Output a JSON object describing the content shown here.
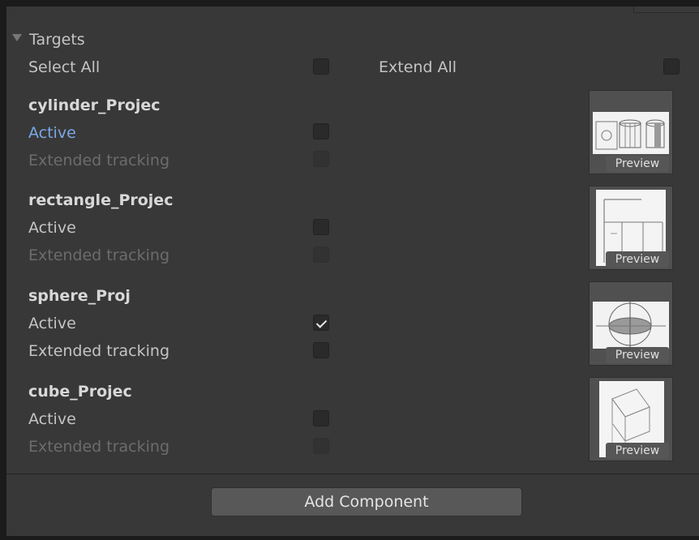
{
  "section": {
    "title": "Targets"
  },
  "bulk": {
    "select_all_label": "Select All",
    "extend_all_label": "Extend All"
  },
  "targets": [
    {
      "name": "cylinder_Projec",
      "active_label": "Active",
      "active_checked": false,
      "active_highlighted": true,
      "extended_label": "Extended tracking",
      "extended_checked": false,
      "extended_enabled": false,
      "preview_label": "Preview"
    },
    {
      "name": "rectangle_Projec",
      "active_label": "Active",
      "active_checked": false,
      "active_highlighted": false,
      "extended_label": "Extended tracking",
      "extended_checked": false,
      "extended_enabled": false,
      "preview_label": "Preview"
    },
    {
      "name": "sphere_Proj",
      "active_label": "Active",
      "active_checked": true,
      "active_highlighted": false,
      "extended_label": "Extended tracking",
      "extended_checked": false,
      "extended_enabled": true,
      "preview_label": "Preview"
    },
    {
      "name": "cube_Projec",
      "active_label": "Active",
      "active_checked": false,
      "active_highlighted": false,
      "extended_label": "Extended tracking",
      "extended_checked": false,
      "extended_enabled": false,
      "preview_label": "Preview"
    }
  ],
  "footer": {
    "add_component_label": "Add Component"
  },
  "colors": {
    "panel": "#383838",
    "highlight_text": "#7ba7e6",
    "disabled_text": "#6c6c6c"
  }
}
